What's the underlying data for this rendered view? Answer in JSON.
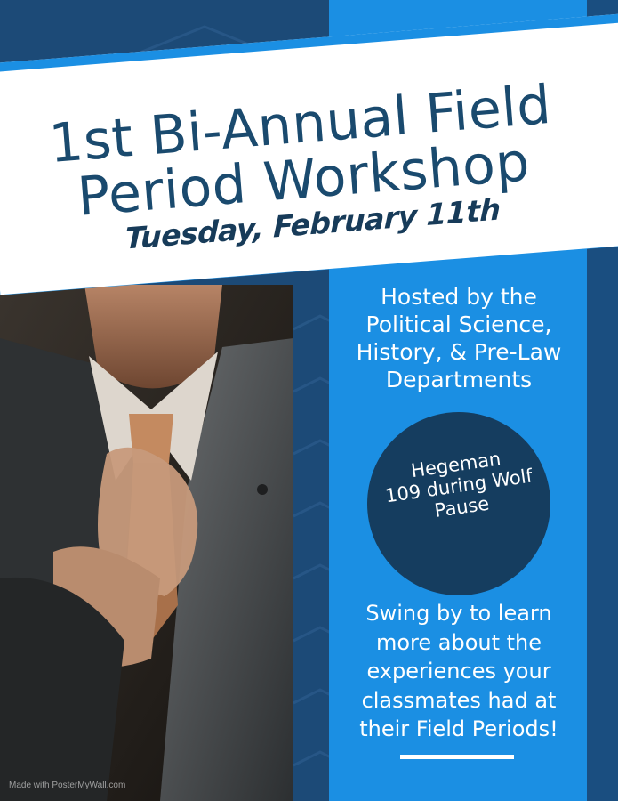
{
  "poster": {
    "title_line1": "1st Bi-Annual Field",
    "title_line2": "Period Workshop",
    "date": "Tuesday, February 11th",
    "hosted_lines": [
      "Hosted by the",
      "Political Science,",
      "History, & Pre-Law",
      "Departments"
    ],
    "location_lines": [
      "Hegeman",
      "109 during Wolf",
      "Pause"
    ],
    "description_lines": [
      "Swing by to learn",
      "more about the",
      "experiences your",
      "classmates had at",
      "their Field Periods!"
    ],
    "watermark": "Made with PosterMyWall.com"
  },
  "colors": {
    "navy": "#1a3d63",
    "bright_blue": "#1b8fe3",
    "title_text": "#1a4a6e",
    "circle": "#153d5f"
  }
}
